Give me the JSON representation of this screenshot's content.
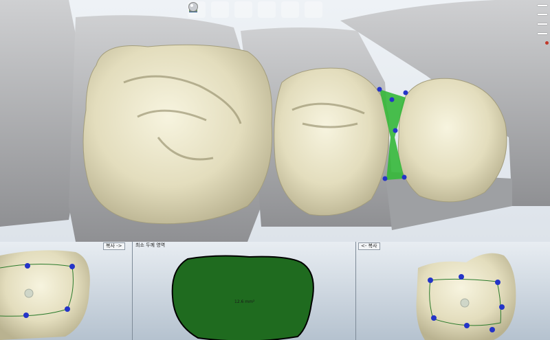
{
  "toolbar": {
    "tools": [
      {
        "icon": "margin-pencil-icon"
      },
      {
        "icon": "tooth-green-icon"
      },
      {
        "icon": "tooth-base-icon"
      },
      {
        "icon": "crown-icon"
      },
      {
        "icon": "tooth-heart-icon"
      },
      {
        "icon": "sphere-icon"
      }
    ]
  },
  "panels": {
    "left_tab": "복사 ->",
    "center_title": "최소 두께 영역",
    "right_tab": "<- 복사",
    "area_value": "12.6 mm²"
  },
  "colors": {
    "tooth": "#e6e1c4",
    "stone": "#b7b8ba",
    "contact_area": "#1f6b1f",
    "handle_point": "#2434c8",
    "contact_highlight": "#35b83a"
  }
}
